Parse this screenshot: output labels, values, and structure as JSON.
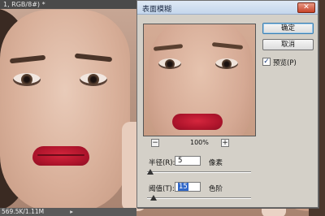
{
  "document": {
    "tab_title": "1, RGB/8#) *",
    "status_text": "569.5K/1.11M",
    "status_arrow": "▸"
  },
  "dialog": {
    "title": "表面模糊",
    "close_label": "✕",
    "ok_label": "确定",
    "cancel_label": "取消",
    "preview_checkbox": {
      "label": "预览(P)",
      "checked": true,
      "check_glyph": "✓"
    },
    "zoom": {
      "value": "100%",
      "zoom_out_label": "−",
      "zoom_in_label": "+"
    },
    "radius": {
      "label": "半径(R):",
      "value": "5",
      "unit": "像素",
      "slider_fraction": 0.03
    },
    "threshold": {
      "label": "阈值(T):",
      "value": "15",
      "unit": "色阶",
      "slider_fraction": 0.06
    }
  },
  "colors": {
    "titlebar": "#c4d6ec",
    "dialog_bg": "#d4d0c8",
    "close_button": "#c8432a",
    "selection": "#3168c9",
    "lips": "#b0152c"
  }
}
